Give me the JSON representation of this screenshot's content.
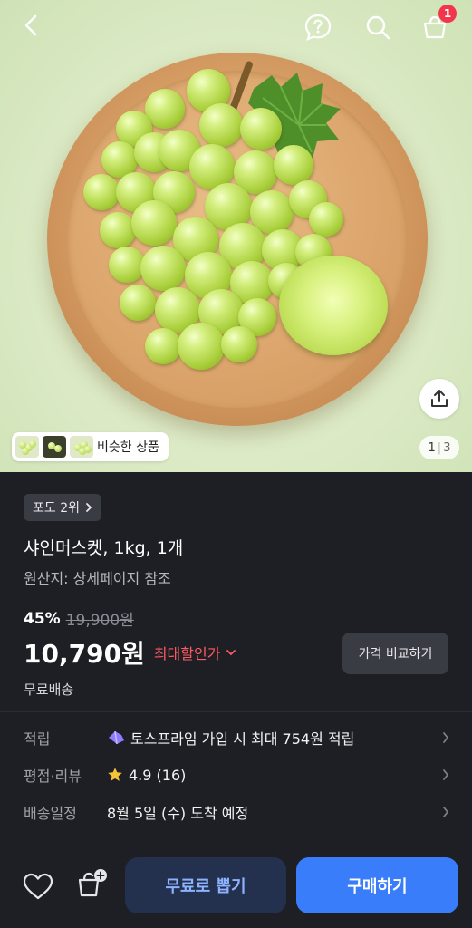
{
  "header": {
    "cart_badge": "1"
  },
  "hero": {
    "similar_label": "비슷한 상품",
    "pager_current": "1",
    "pager_total": "3"
  },
  "product": {
    "rank_chip": "포도 2위",
    "title": "샤인머스켓, 1kg, 1개",
    "origin": "원산지: 상세페이지 참조",
    "discount_percent": "45%",
    "original_price": "19,900원",
    "price": "10,790원",
    "max_discount_label": "최대할인가",
    "compare_button": "가격 비교하기",
    "shipping": "무료배송"
  },
  "info_rows": [
    {
      "label": "적립",
      "value": "토스프라임 가입 시 최대 754원 적립",
      "icon": "toss-prime-icon"
    },
    {
      "label": "평점·리뷰",
      "value": "4.9 (16)",
      "icon": "star-icon"
    },
    {
      "label": "배송일정",
      "value": "8월 5일 (수) 도착 예정"
    }
  ],
  "bottom_bar": {
    "free_button": "무료로 뽑기",
    "buy_button": "구매하기"
  },
  "colors": {
    "background": "#1e1f24",
    "accent_blue": "#3a7dfb",
    "discount_red": "#ff5a62",
    "badge_red": "#f2354d"
  }
}
